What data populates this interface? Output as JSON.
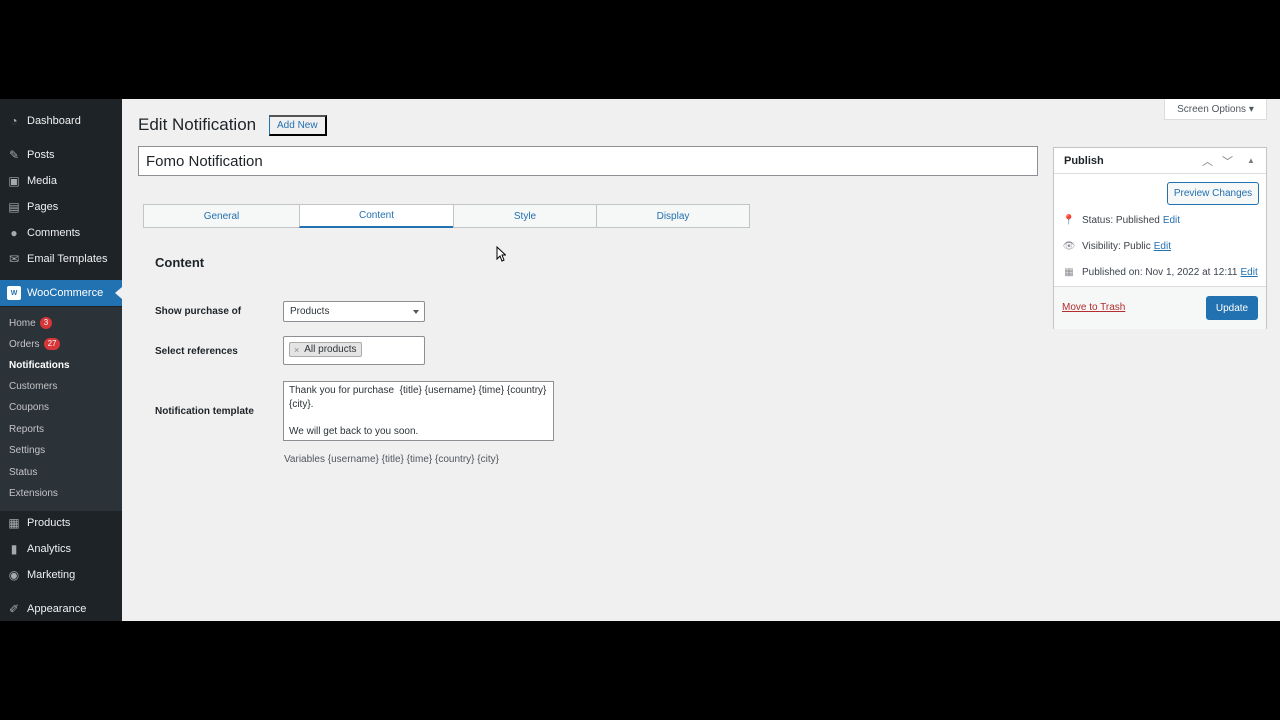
{
  "sidebar": {
    "items": [
      {
        "label": "Dashboard",
        "icon": "dashboard-icon"
      },
      {
        "label": "Posts",
        "icon": "pin-icon"
      },
      {
        "label": "Media",
        "icon": "media-icon"
      },
      {
        "label": "Pages",
        "icon": "pages-icon"
      },
      {
        "label": "Comments",
        "icon": "comment-icon"
      },
      {
        "label": "Email Templates",
        "icon": "email-icon"
      },
      {
        "label": "WooCommerce",
        "icon": "woo-icon"
      },
      {
        "label": "Products",
        "icon": "archive-icon"
      },
      {
        "label": "Analytics",
        "icon": "chart-icon"
      },
      {
        "label": "Marketing",
        "icon": "megaphone-icon"
      },
      {
        "label": "Appearance",
        "icon": "brush-icon"
      }
    ],
    "submenu": [
      {
        "label": "Home",
        "badge": "3"
      },
      {
        "label": "Orders",
        "badge": "27"
      },
      {
        "label": "Notifications"
      },
      {
        "label": "Customers"
      },
      {
        "label": "Coupons"
      },
      {
        "label": "Reports"
      },
      {
        "label": "Settings"
      },
      {
        "label": "Status"
      },
      {
        "label": "Extensions"
      }
    ]
  },
  "header": {
    "title": "Edit Notification",
    "add_new": "Add New",
    "screen_options": "Screen Options ▾"
  },
  "post_title": "Fomo Notification",
  "tabs": [
    "General",
    "Content",
    "Style",
    "Display"
  ],
  "active_tab": "Content",
  "content": {
    "heading": "Content",
    "show_purchase_label": "Show purchase of",
    "show_purchase_value": "Products",
    "select_refs_label": "Select references",
    "ref_tag": "All products",
    "ref_tag_remove": "×",
    "template_label": "Notification template",
    "template_value": "Thank you for purchase  {title} {username} {time} {country} {city}.\n\nWe will get back to you soon.",
    "variables_note": "Variables {username} {title} {time} {country} {city}"
  },
  "publish": {
    "title": "Publish",
    "preview_btn": "Preview Changes",
    "status_label": "Status: Published",
    "visibility_label": "Visibility: Public",
    "published_on_label": "Published on: Nov 1, 2022 at 12:11",
    "edit": "Edit",
    "trash": "Move to Trash",
    "update_btn": "Update"
  },
  "colors": {
    "accent": "#2271b1",
    "sidebar_bg": "#1d2327",
    "badge": "#d63638"
  }
}
